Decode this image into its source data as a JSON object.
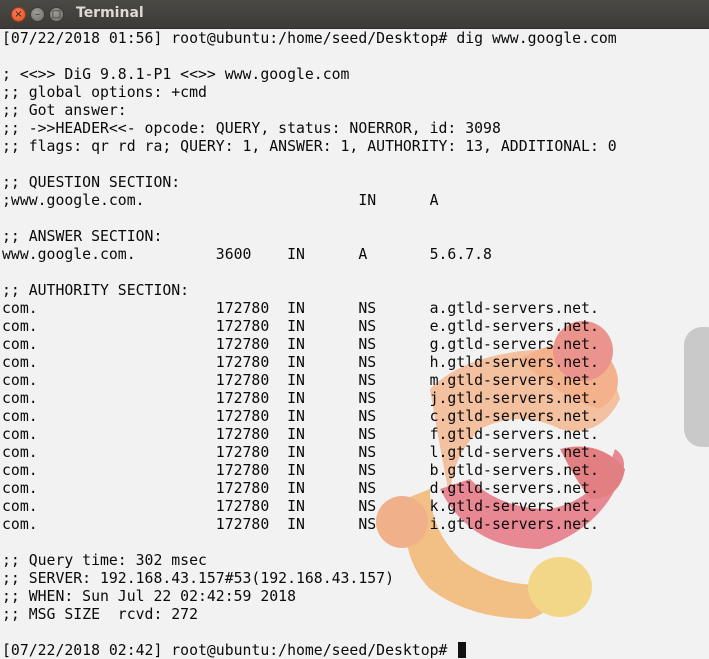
{
  "window": {
    "title": "Terminal",
    "close_glyph": "×",
    "minimize_glyph": "–",
    "maximize_glyph": "□"
  },
  "terminal": {
    "lines": [
      "[07/22/2018 01:56] root@ubuntu:/home/seed/Desktop# dig www.google.com",
      "",
      "; <<>> DiG 9.8.1-P1 <<>> www.google.com",
      ";; global options: +cmd",
      ";; Got answer:",
      ";; ->>HEADER<<- opcode: QUERY, status: NOERROR, id: 3098",
      ";; flags: qr rd ra; QUERY: 1, ANSWER: 1, AUTHORITY: 13, ADDITIONAL: 0",
      "",
      ";; QUESTION SECTION:",
      ";www.google.com.                        IN      A",
      "",
      ";; ANSWER SECTION:",
      "www.google.com.         3600    IN      A       5.6.7.8",
      "",
      ";; AUTHORITY SECTION:",
      "com.                    172780  IN      NS      a.gtld-servers.net.",
      "com.                    172780  IN      NS      e.gtld-servers.net.",
      "com.                    172780  IN      NS      g.gtld-servers.net.",
      "com.                    172780  IN      NS      h.gtld-servers.net.",
      "com.                    172780  IN      NS      m.gtld-servers.net.",
      "com.                    172780  IN      NS      j.gtld-servers.net.",
      "com.                    172780  IN      NS      c.gtld-servers.net.",
      "com.                    172780  IN      NS      f.gtld-servers.net.",
      "com.                    172780  IN      NS      l.gtld-servers.net.",
      "com.                    172780  IN      NS      b.gtld-servers.net.",
      "com.                    172780  IN      NS      d.gtld-servers.net.",
      "com.                    172780  IN      NS      k.gtld-servers.net.",
      "com.                    172780  IN      NS      i.gtld-servers.net.",
      "",
      ";; Query time: 302 msec",
      ";; SERVER: 192.168.43.157#53(192.168.43.157)",
      ";; WHEN: Sun Jul 22 02:42:59 2018",
      ";; MSG SIZE  rcvd: 272",
      ""
    ],
    "prompt": "[07/22/2018 02:42] root@ubuntu:/home/seed/Desktop# "
  },
  "colors": {
    "titlebar": "#3c3b37",
    "title_text": "#dfdbd2",
    "close_button": "#e1501f",
    "text": "#0a0a0a"
  },
  "icons": [
    "close-icon",
    "minimize-icon",
    "maximize-icon",
    "ubuntu-logo-wallpaper"
  ]
}
